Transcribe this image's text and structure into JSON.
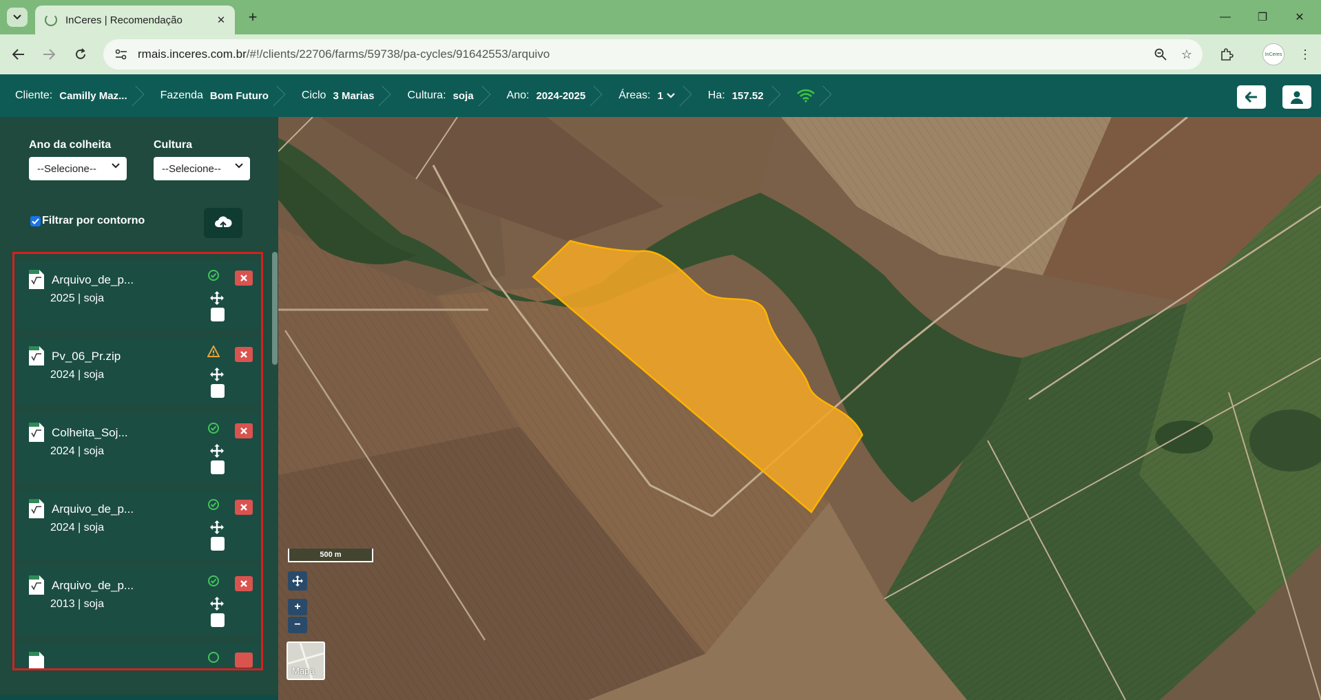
{
  "browser": {
    "tab_title": "InCeres | Recomendação",
    "url_host": "rmais.inceres.com.br",
    "url_path": "/#!/clients/22706/farms/59738/pa-cycles/91642553/arquivo",
    "profile_text": "InCeres"
  },
  "header": {
    "crumbs": [
      {
        "label": "Cliente:",
        "value": "Camilly Maz..."
      },
      {
        "label": "Fazenda",
        "value": "Bom Futuro"
      },
      {
        "label": "Ciclo",
        "value": "3 Marias"
      },
      {
        "label": "Cultura:",
        "value": "soja"
      },
      {
        "label": "Ano:",
        "value": "2024-2025"
      },
      {
        "label": "Áreas:",
        "value": "1"
      },
      {
        "label": "Ha:",
        "value": "157.52"
      }
    ]
  },
  "sidebar": {
    "harvest_year_label": "Ano da colheita",
    "harvest_year_value": "--Selecione--",
    "crop_label": "Cultura",
    "crop_value": "--Selecione--",
    "filter_contour_label": "Filtrar por contorno",
    "filter_contour_checked": true,
    "files": [
      {
        "name": "Arquivo_de_p...",
        "meta": "2025 | soja",
        "status": "ok"
      },
      {
        "name": "Pv_06_Pr.zip",
        "meta": "2024 | soja",
        "status": "warning"
      },
      {
        "name": "Colheita_Soj...",
        "meta": "2024 | soja",
        "status": "ok"
      },
      {
        "name": "Arquivo_de_p...",
        "meta": "2024 | soja",
        "status": "ok"
      },
      {
        "name": "Arquivo_de_p...",
        "meta": "2013 | soja",
        "status": "ok"
      }
    ]
  },
  "map": {
    "scale_label": "500 m",
    "zoom_in": "+",
    "zoom_out": "−",
    "basemap_label": "Mapa",
    "field_color": "#f0a526"
  },
  "colors": {
    "header_bg": "#0e5b55",
    "sidebar_bg": "#1f4a3d",
    "highlight_border": "#d62020"
  }
}
